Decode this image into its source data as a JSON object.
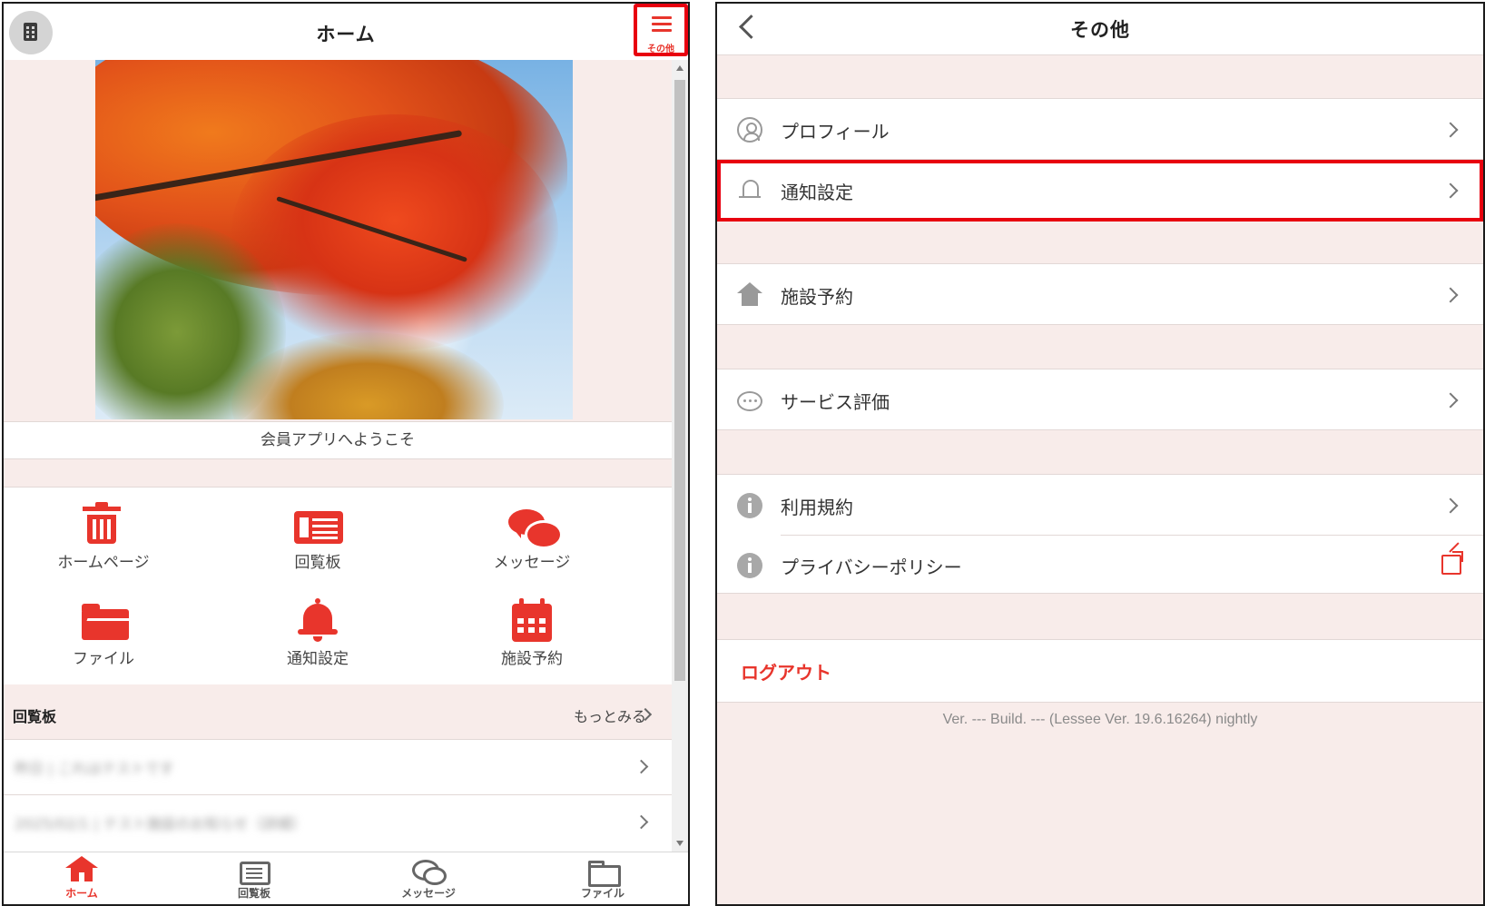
{
  "left": {
    "header": {
      "title": "ホーム",
      "menu_label": "その他"
    },
    "welcome": "会員アプリへようこそ",
    "grid": [
      {
        "label": "ホームページ",
        "icon": "trash-icon"
      },
      {
        "label": "回覧板",
        "icon": "board-icon"
      },
      {
        "label": "メッセージ",
        "icon": "chat-bubbles-icon"
      },
      {
        "label": "ファイル",
        "icon": "folder-icon"
      },
      {
        "label": "通知設定",
        "icon": "bell-icon"
      },
      {
        "label": "施設予約",
        "icon": "calendar-icon"
      }
    ],
    "circular": {
      "title": "回覧板",
      "more": "もっとみる",
      "items": [
        "昨日 | これはテストです",
        "2025/02/1 | テスト施設のお知らせ（詳細）"
      ]
    },
    "tabs": [
      {
        "label": "ホーム",
        "icon": "home-icon",
        "active": true
      },
      {
        "label": "回覧板",
        "icon": "board-icon",
        "active": false
      },
      {
        "label": "メッセージ",
        "icon": "chat-bubbles-icon",
        "active": false
      },
      {
        "label": "ファイル",
        "icon": "folder-icon",
        "active": false
      }
    ]
  },
  "right": {
    "header": {
      "title": "その他"
    },
    "menu": [
      {
        "label": "プロフィール",
        "icon": "user-circle-icon"
      },
      {
        "label": "通知設定",
        "icon": "bell-outline-icon"
      },
      {
        "label": "施設予約",
        "icon": "house-icon"
      },
      {
        "label": "サービス評価",
        "icon": "chat-dots-icon"
      },
      {
        "label": "利用規約",
        "icon": "info-icon"
      },
      {
        "label": "プライバシーポリシー",
        "icon": "info-icon"
      }
    ],
    "logout": "ログアウト",
    "version": "Ver. --- Build. --- (Lessee Ver. 19.6.16264) nightly"
  },
  "colors": {
    "accent": "#e8352c",
    "highlight_border": "#e8000f",
    "background_tint": "#f8ecea"
  }
}
